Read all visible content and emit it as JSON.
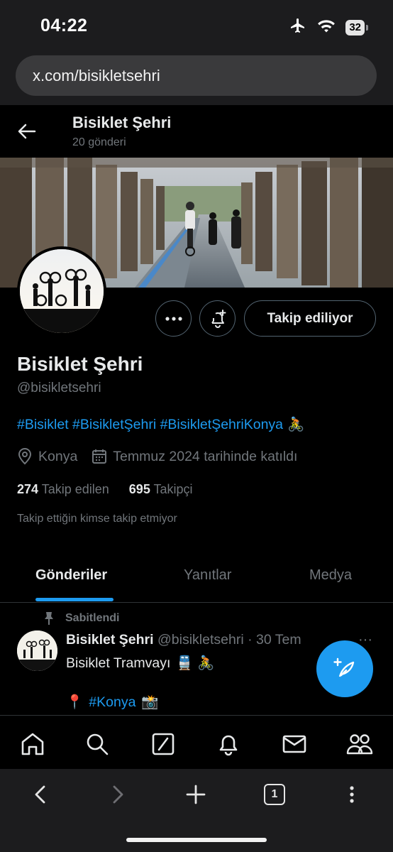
{
  "status_bar": {
    "time": "04:22",
    "battery": "32"
  },
  "browser": {
    "url": "x.com/bisikletsehri",
    "tab_count": "1"
  },
  "header": {
    "title": "Bisiklet Şehri",
    "subtitle": "20 gönderi"
  },
  "profile": {
    "name": "Bisiklet Şehri",
    "handle": "@bisikletsehri",
    "follow_label": "Takip ediliyor",
    "bio": "#Bisiklet #BisikletŞehri #BisikletŞehriKonya",
    "bio_emoji": "🚴",
    "location": "Konya",
    "joined": "Temmuz 2024 tarihinde katıldı",
    "following_count": "274",
    "following_label": "Takip edilen",
    "followers_count": "695",
    "followers_label": "Takipçi",
    "followers_note": "Takip ettiğin kimse takip etmiyor"
  },
  "tabs": [
    {
      "label": "Gönderiler",
      "active": true
    },
    {
      "label": "Yanıtlar",
      "active": false
    },
    {
      "label": "Medya",
      "active": false
    }
  ],
  "pinned_post": {
    "pinned_label": "Sabitlendi",
    "author": "Bisiklet Şehri",
    "meta": "@bisikletsehri · 30 Tem",
    "more": "···",
    "text": "Bisiklet Tramvayı",
    "text_emoji": "🚆 🚴",
    "pin_emoji": "📍",
    "hashtag": "#Konya",
    "camera_emoji": "📸"
  },
  "icons": {
    "back": "arrow-left-icon",
    "more": "more-icon",
    "notify": "bell-plus-icon",
    "location": "location-pin-icon",
    "calendar": "calendar-icon",
    "pin": "pin-icon",
    "compose": "feather-plus-icon"
  },
  "colors": {
    "accent": "#1d9bf0",
    "muted": "#71767b",
    "text": "#e7e9ea",
    "background": "#000000"
  }
}
